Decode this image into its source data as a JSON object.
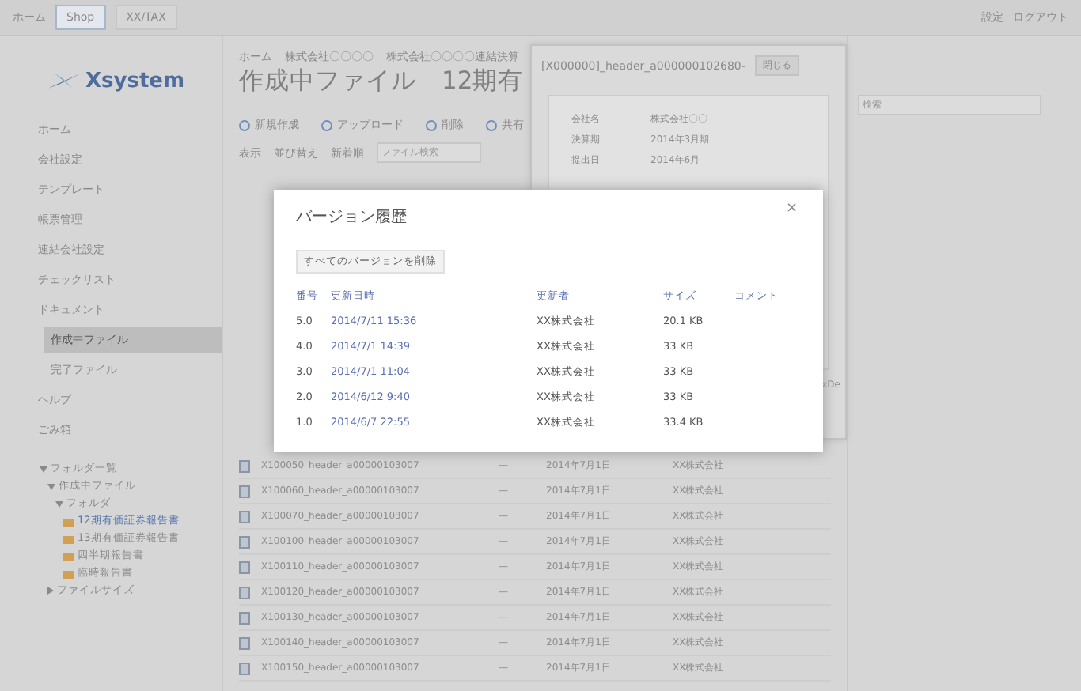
{
  "topbar": {
    "app_label": "ホーム",
    "tabs": [
      {
        "label": "Shop",
        "selected": true
      },
      {
        "label": "XX/TAX",
        "selected": false
      }
    ],
    "links": [
      "設定",
      "ログアウト"
    ]
  },
  "logo": "Xsystem",
  "breadcrumb": [
    "ホーム",
    "株式会社〇〇〇〇",
    "株式会社〇〇〇〇連結決算"
  ],
  "page_title": "作成中ファイル　12期有",
  "toolbar": [
    "新規作成",
    "アップロード",
    "削除",
    "共有"
  ],
  "filters": [
    "表示",
    "並び替え",
    "新着順"
  ],
  "search": {
    "placeholder": "ファイル検索"
  },
  "sidebar": {
    "items": [
      {
        "label": "ホーム",
        "selected": false
      },
      {
        "label": "会社設定",
        "selected": false
      },
      {
        "label": "テンプレート",
        "selected": false
      },
      {
        "label": "帳票管理",
        "selected": false
      },
      {
        "label": "連結会社設定",
        "selected": false
      },
      {
        "label": "チェックリスト",
        "selected": false
      },
      {
        "label": "ドキュメント",
        "selected": false
      },
      {
        "label": "作成中ファイル",
        "selected": true
      },
      {
        "label": "完了ファイル",
        "selected": false
      },
      {
        "label": "ヘルプ",
        "selected": false
      },
      {
        "label": "ごみ箱",
        "selected": false
      }
    ],
    "tree": [
      {
        "label": "フォルダ一覧",
        "expanded": true,
        "children": [
          {
            "label": "作成中ファイル",
            "expanded": true,
            "children": [
              {
                "label": "フォルダ",
                "expanded": true,
                "children": [
                  {
                    "label": "12期有価証券報告書",
                    "selected": true
                  },
                  {
                    "label": "13期有価証券報告書",
                    "selected": false
                  },
                  {
                    "label": "四半期報告書",
                    "selected": false
                  },
                  {
                    "label": "臨時報告書",
                    "selected": false
                  }
                ]
              }
            ]
          },
          {
            "label": "ファイルサイズ",
            "expanded": false
          }
        ]
      }
    ]
  },
  "files": [
    {
      "name": "X100050_header_a00000103007",
      "dash": "—",
      "date": "2014年7月1日",
      "owner": "XX株式会社"
    },
    {
      "name": "X100060_header_a00000103007",
      "dash": "—",
      "date": "2014年7月1日",
      "owner": "XX株式会社"
    },
    {
      "name": "X100070_header_a00000103007",
      "dash": "—",
      "date": "2014年7月1日",
      "owner": "XX株式会社"
    },
    {
      "name": "X100100_header_a00000103007",
      "dash": "—",
      "date": "2014年7月1日",
      "owner": "XX株式会社"
    },
    {
      "name": "X100110_header_a00000103007",
      "dash": "—",
      "date": "2014年7月1日",
      "owner": "XX株式会社"
    },
    {
      "name": "X100120_header_a00000103007",
      "dash": "—",
      "date": "2014年7月1日",
      "owner": "XX株式会社"
    },
    {
      "name": "X100130_header_a00000103007",
      "dash": "—",
      "date": "2014年7月1日",
      "owner": "XX株式会社"
    },
    {
      "name": "X100140_header_a00000103007",
      "dash": "—",
      "date": "2014年7月1日",
      "owner": "XX株式会社"
    },
    {
      "name": "X100150_header_a00000103007",
      "dash": "—",
      "date": "2014年7月1日",
      "owner": "XX株式会社"
    }
  ],
  "preview": {
    "title": "[X000000]_header_a000000102680-",
    "button": "閉じる",
    "side_text": "xDe",
    "fields": [
      {
        "label": "会社名",
        "value": "株式会社〇〇"
      },
      {
        "label": "決算期",
        "value": "2014年3月期"
      },
      {
        "label": "提出日",
        "value": "2014年6月"
      }
    ]
  },
  "right_search": {
    "placeholder": "検索"
  },
  "dialog": {
    "title": "バージョン履歴",
    "close": "×",
    "action": "すべてのバージョンを削除",
    "columns": [
      "番号",
      "更新日時",
      "更新者",
      "サイズ",
      "コメント"
    ],
    "rows": [
      {
        "number": "5.0",
        "date": "2014/7/11 15:36",
        "user": "XX株式会社",
        "size": "20.1 KB"
      },
      {
        "number": "4.0",
        "date": "2014/7/1 14:39",
        "user": "XX株式会社",
        "size": "33 KB"
      },
      {
        "number": "3.0",
        "date": "2014/7/1 11:04",
        "user": "XX株式会社",
        "size": "33 KB"
      },
      {
        "number": "2.0",
        "date": "2014/6/12 9:40",
        "user": "XX株式会社",
        "size": "33 KB"
      },
      {
        "number": "1.0",
        "date": "2014/6/7 22:55",
        "user": "XX株式会社",
        "size": "33.4 KB"
      }
    ]
  }
}
